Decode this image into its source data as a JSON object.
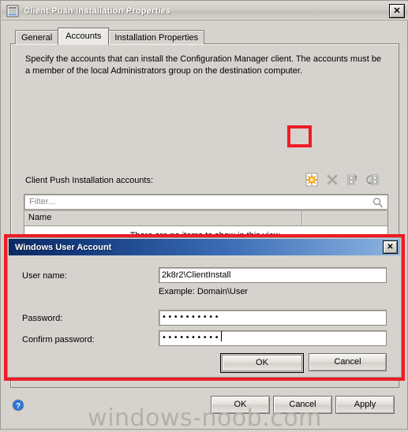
{
  "window": {
    "title": "Client Push Installation Properties",
    "icon": "properties-window-icon",
    "close_label": "✕"
  },
  "tabs": [
    {
      "label": "General",
      "selected": false
    },
    {
      "label": "Accounts",
      "selected": true
    },
    {
      "label": "Installation Properties",
      "selected": false
    }
  ],
  "accounts_tab": {
    "description": "Specify the accounts that can install the Configuration Manager client. The accounts must be a member of the local Administrators group on the destination computer.",
    "accounts_label": "Client Push Installation accounts:",
    "toolbar": [
      {
        "name": "new-account-icon",
        "tooltip": "New",
        "highlighted": true
      },
      {
        "name": "delete-icon",
        "tooltip": "Delete",
        "highlighted": false
      },
      {
        "name": "move-up-icon",
        "tooltip": "Move Up",
        "highlighted": false
      },
      {
        "name": "move-down-icon",
        "tooltip": "Move Down",
        "highlighted": false
      }
    ],
    "filter": {
      "placeholder": "Filter...",
      "value": "",
      "search_icon": "magnifier-icon"
    },
    "grid": {
      "columns": [
        "Name",
        ""
      ],
      "empty_message": "There are no items to show in this view.",
      "rows": []
    }
  },
  "footer": {
    "help_icon": "help-circle-icon",
    "ok_label": "OK",
    "cancel_label": "Cancel",
    "apply_label": "Apply"
  },
  "watermark": "windows-noob.com",
  "inner_dialog": {
    "title": "Windows User Account",
    "close_label": "✕",
    "username_label": "User name:",
    "username_value": "2k8r2\\ClientInstall",
    "example_text": "Example: Domain\\User",
    "password_label": "Password:",
    "password_value": "••••••••••",
    "confirm_label": "Confirm password:",
    "confirm_value": "••••••••••",
    "ok_label": "OK",
    "cancel_label": "Cancel"
  },
  "colors": {
    "highlight_red": "#ee1c25",
    "dialog_face": "#d6d3ce",
    "inner_title_start": "#0b2a63",
    "inner_title_end": "#8db4e2",
    "star_icon": "#ffb600"
  }
}
